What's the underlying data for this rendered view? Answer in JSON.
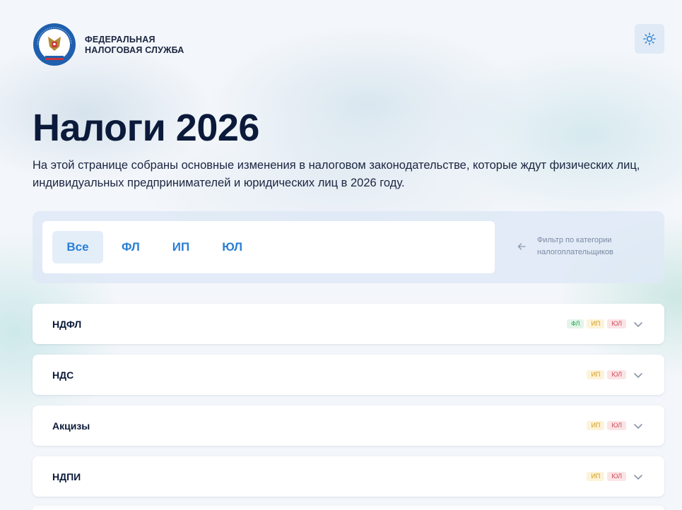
{
  "header": {
    "brand_line1": "ФЕДЕРАЛЬНАЯ",
    "brand_line2": "НАЛОГОВАЯ СЛУЖБА",
    "logo_icon": "fns-emblem-icon",
    "theme_icon": "sun-icon"
  },
  "page": {
    "title": "Налоги 2026",
    "description": "На этой странице собраны основные изменения в налоговом законодательстве, которые ждут физических лиц, индивидуальных предпринимателей и юридических лиц в 2026 году."
  },
  "filter": {
    "tabs": [
      {
        "label": "Все",
        "active": true
      },
      {
        "label": "ФЛ",
        "active": false
      },
      {
        "label": "ИП",
        "active": false
      },
      {
        "label": "ЮЛ",
        "active": false
      }
    ],
    "hint_line1": "Фильтр по категории",
    "hint_line2": "налогоплательщиков"
  },
  "sections": [
    {
      "title": "НДФЛ",
      "badges": [
        "ФЛ",
        "ИП",
        "ЮЛ"
      ]
    },
    {
      "title": "НДС",
      "badges": [
        "ИП",
        "ЮЛ"
      ]
    },
    {
      "title": "Акцизы",
      "badges": [
        "ИП",
        "ЮЛ"
      ]
    },
    {
      "title": "НДПИ",
      "badges": [
        "ИП",
        "ЮЛ"
      ]
    }
  ],
  "colors": {
    "accent": "#2a7fd4",
    "badge_fl": "#27a255",
    "badge_ip": "#d39a1b",
    "badge_ul": "#d04a57"
  }
}
